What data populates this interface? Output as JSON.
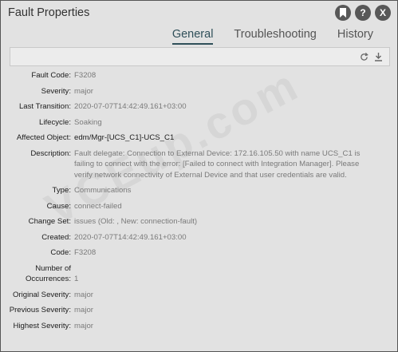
{
  "dialog": {
    "title": "Fault Properties",
    "tabs": [
      {
        "label": "General",
        "active": true
      },
      {
        "label": "Troubleshooting",
        "active": false
      },
      {
        "label": "History",
        "active": false
      }
    ],
    "header_icons": [
      "bookmark-icon",
      "help-icon",
      "close-icon"
    ],
    "toolbar_icons": [
      "refresh-icon",
      "download-icon"
    ]
  },
  "props": {
    "fault_code": {
      "label": "Fault Code:",
      "value": "F3208"
    },
    "severity": {
      "label": "Severity:",
      "value": "major"
    },
    "last_transition": {
      "label": "Last Transition:",
      "value": "2020-07-07T14:42:49.161+03:00"
    },
    "lifecycle": {
      "label": "Lifecycle:",
      "value": "Soaking"
    },
    "affected_object": {
      "label": "Affected Object:",
      "value": "edm/Mgr-[UCS_C1]-UCS_C1"
    },
    "description": {
      "label": "Description:",
      "value": "Fault delegate: Connection to External Device: 172.16.105.50 with name UCS_C1 is failing to connect with the error: [Failed to connect with Integration Manager]. Please verify network connectivity of External Device and that user credentials are valid."
    },
    "type": {
      "label": "Type:",
      "value": "Communications"
    },
    "cause": {
      "label": "Cause:",
      "value": "connect-failed"
    },
    "change_set": {
      "label": "Change Set:",
      "value": "issues (Old: , New: connection-fault)"
    },
    "created": {
      "label": "Created:",
      "value": "2020-07-07T14:42:49.161+03:00"
    },
    "code": {
      "label": "Code:",
      "value": "F3208"
    },
    "occurrences": {
      "label": "Number of Occurrences:",
      "value": "1"
    },
    "original_severity": {
      "label": "Original Severity:",
      "value": "major"
    },
    "previous_severity": {
      "label": "Previous Severity:",
      "value": "major"
    },
    "highest_severity": {
      "label": "Highest Severity:",
      "value": "major"
    }
  },
  "watermark": "VCEup.com"
}
